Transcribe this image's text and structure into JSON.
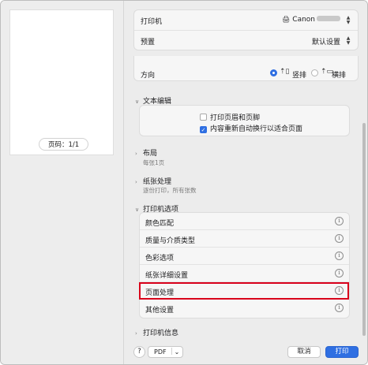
{
  "preview": {
    "page_counter": "页码：1/1"
  },
  "printer": {
    "label": "打印机",
    "value": "Canon"
  },
  "presets": {
    "label": "预置",
    "value": "默认设置"
  },
  "orientation": {
    "label": "方向",
    "portrait": "竖排",
    "landscape": "横排",
    "selected": "portrait"
  },
  "text_edit": {
    "title": "文本编辑",
    "options": [
      {
        "label": "打印页眉和页脚",
        "checked": false
      },
      {
        "label": "内容重新自动换行以适合页面",
        "checked": true
      }
    ]
  },
  "layout": {
    "title": "布局",
    "summary": "每张1页"
  },
  "paper_handling": {
    "title": "纸张处理",
    "summary": "逐份打印，所有张数"
  },
  "printer_options": {
    "title": "打印机选项",
    "items": [
      "颜色匹配",
      "质量与介质类型",
      "色彩选项",
      "纸张详细设置",
      "页面处理",
      "其他设置"
    ],
    "highlighted": "页面处理"
  },
  "printer_info": {
    "title": "打印机信息"
  },
  "footer": {
    "help": "?",
    "pdf": "PDF",
    "cancel": "取消",
    "print": "打印"
  },
  "colors": {
    "accent": "#2f6fe2",
    "highlight": "#d9001b"
  }
}
